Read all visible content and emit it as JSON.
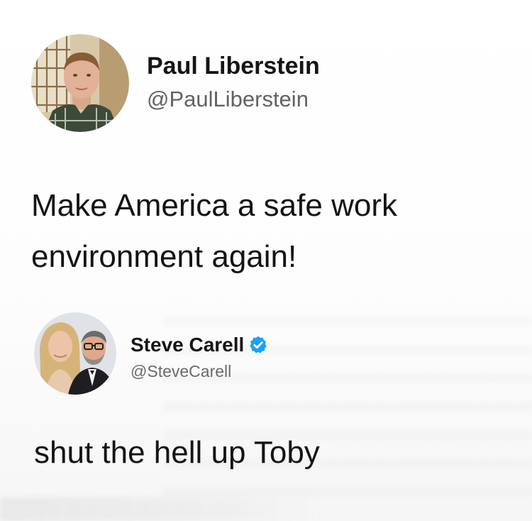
{
  "tweets": [
    {
      "display_name": "Paul Liberstein",
      "handle": "@PaulLiberstein",
      "verified": false,
      "text": "Make America a safe work environment again!"
    },
    {
      "display_name": "Steve Carell",
      "handle": "@SteveCarell",
      "verified": true,
      "text": "shut the hell up Toby"
    }
  ],
  "colors": {
    "background": "#ffffff",
    "name": "#151515",
    "handle": "#626262",
    "verified_badge": "#1da1f2"
  },
  "icons": {
    "avatar1": "avatar-icon",
    "avatar2": "avatar-icon",
    "verified": "verified-badge-icon"
  }
}
